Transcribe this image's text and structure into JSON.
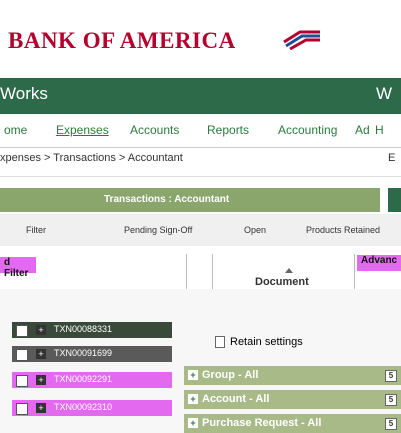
{
  "brand": {
    "logo_text": "BANK OF AMERICA"
  },
  "title_bar": {
    "left_text": "Works",
    "right_text": "W"
  },
  "nav": {
    "items": [
      "ome",
      "Expenses",
      "Accounts",
      "Reports",
      "Accounting",
      "Ad",
      "H"
    ],
    "selected": "Expenses"
  },
  "breadcrumb": {
    "text": "xpenses > Transactions > Accountant",
    "right": "E"
  },
  "tabs": {
    "text": "Transactions : Accountant"
  },
  "toolbar": {
    "items": [
      "Filter",
      "Pending Sign-Off",
      "Open",
      "Products Retained"
    ]
  },
  "filter": {
    "label": "d Filter"
  },
  "advanced": {
    "label": "Advanc"
  },
  "grid": {
    "column_header": "Document",
    "rows": [
      {
        "id": "TXN00088331"
      },
      {
        "id": "TXN00091699"
      },
      {
        "id": "TXN00092291"
      },
      {
        "id": "TXN00092310"
      }
    ]
  },
  "retain": {
    "label": "Retain settings"
  },
  "panel": {
    "items": [
      {
        "label": "Group - All"
      },
      {
        "label": "Account - All"
      },
      {
        "label": "Purchase Request - All"
      }
    ]
  },
  "colors": {
    "brand_red": "#b4002d",
    "header_green": "#2d6a4a",
    "nav_green": "#2b7a3b",
    "tab_green": "#8aa66c",
    "panel_green": "#a7ba87",
    "highlight_pink": "#e36af0"
  }
}
